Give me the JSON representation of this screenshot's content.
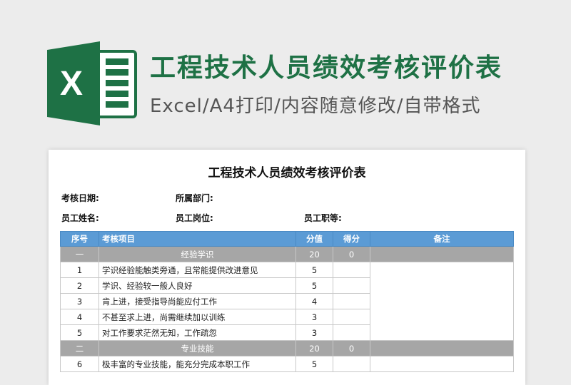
{
  "banner": {
    "title": "工程技术人员绩效考核评价表",
    "subtitle": "Excel/A4打印/内容随意修改/自带格式",
    "logo_letter": "X"
  },
  "sheet": {
    "title": "工程技术人员绩效考核评价表",
    "fields": {
      "date": "考核日期:",
      "dept": "所属部门:",
      "name": "员工姓名:",
      "post": "员工岗位:",
      "rank": "员工职等:"
    },
    "headers": [
      "序号",
      "考核项目",
      "分值",
      "得分",
      "备注"
    ],
    "sections": [
      {
        "no": "一",
        "item": "经验学识",
        "score": "20",
        "got": "0",
        "rows": [
          {
            "no": "1",
            "item": "学识经验能触类旁通，且常能提供改进意见",
            "score": "5"
          },
          {
            "no": "2",
            "item": "学识、经验较一般人良好",
            "score": "5"
          },
          {
            "no": "3",
            "item": "肯上进，接受指导尚能应付工作",
            "score": "4"
          },
          {
            "no": "4",
            "item": "不甚至求上进，尚需继续加以训练",
            "score": "3"
          },
          {
            "no": "5",
            "item": "对工作要求茫然无知，工作疏忽",
            "score": "3"
          }
        ]
      },
      {
        "no": "二",
        "item": "专业技能",
        "score": "20",
        "got": "0",
        "rows": [
          {
            "no": "6",
            "item": "极丰富的专业技能，能充分完成本职工作",
            "score": "5"
          }
        ]
      }
    ]
  },
  "colors": {
    "brand_green": "#1e7145",
    "header_blue": "#5b9bd5",
    "section_gray": "#a6a6a6"
  }
}
